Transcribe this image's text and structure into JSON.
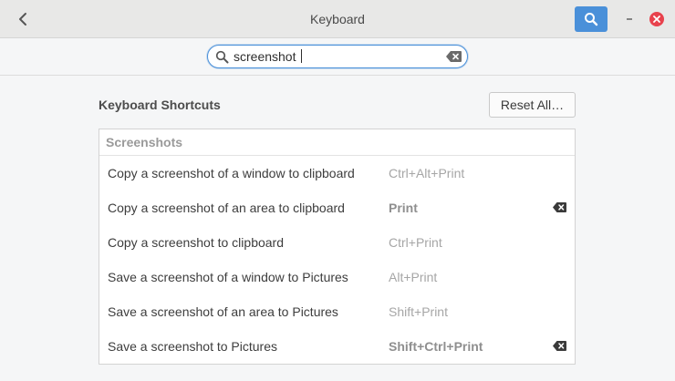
{
  "window": {
    "title": "Keyboard"
  },
  "search": {
    "value": "screenshot"
  },
  "section": {
    "title": "Keyboard Shortcuts",
    "reset_all_label": "Reset All…"
  },
  "list": {
    "header": "Screenshots",
    "rows": [
      {
        "description": "Copy a screenshot of a window to clipboard",
        "accelerator": "Ctrl+Alt+Print",
        "modified": false
      },
      {
        "description": "Copy a screenshot of an area to clipboard",
        "accelerator": "Print",
        "modified": true
      },
      {
        "description": "Copy a screenshot to clipboard",
        "accelerator": "Ctrl+Print",
        "modified": false
      },
      {
        "description": "Save a screenshot of a window to Pictures",
        "accelerator": "Alt+Print",
        "modified": false
      },
      {
        "description": "Save a screenshot of an area to Pictures",
        "accelerator": "Shift+Print",
        "modified": false
      },
      {
        "description": "Save a screenshot to Pictures",
        "accelerator": "Shift+Ctrl+Print",
        "modified": true
      }
    ]
  },
  "colors": {
    "accent": "#4a90d9",
    "close": "#e8424d",
    "headerbar": "#e8e8e7",
    "background": "#f5f6f7"
  },
  "icons": {
    "back": "chevron-left-icon",
    "search": "search-icon",
    "minimize": "minimize-icon",
    "close": "close-icon",
    "clear": "backspace-icon",
    "reset": "backspace-icon"
  }
}
